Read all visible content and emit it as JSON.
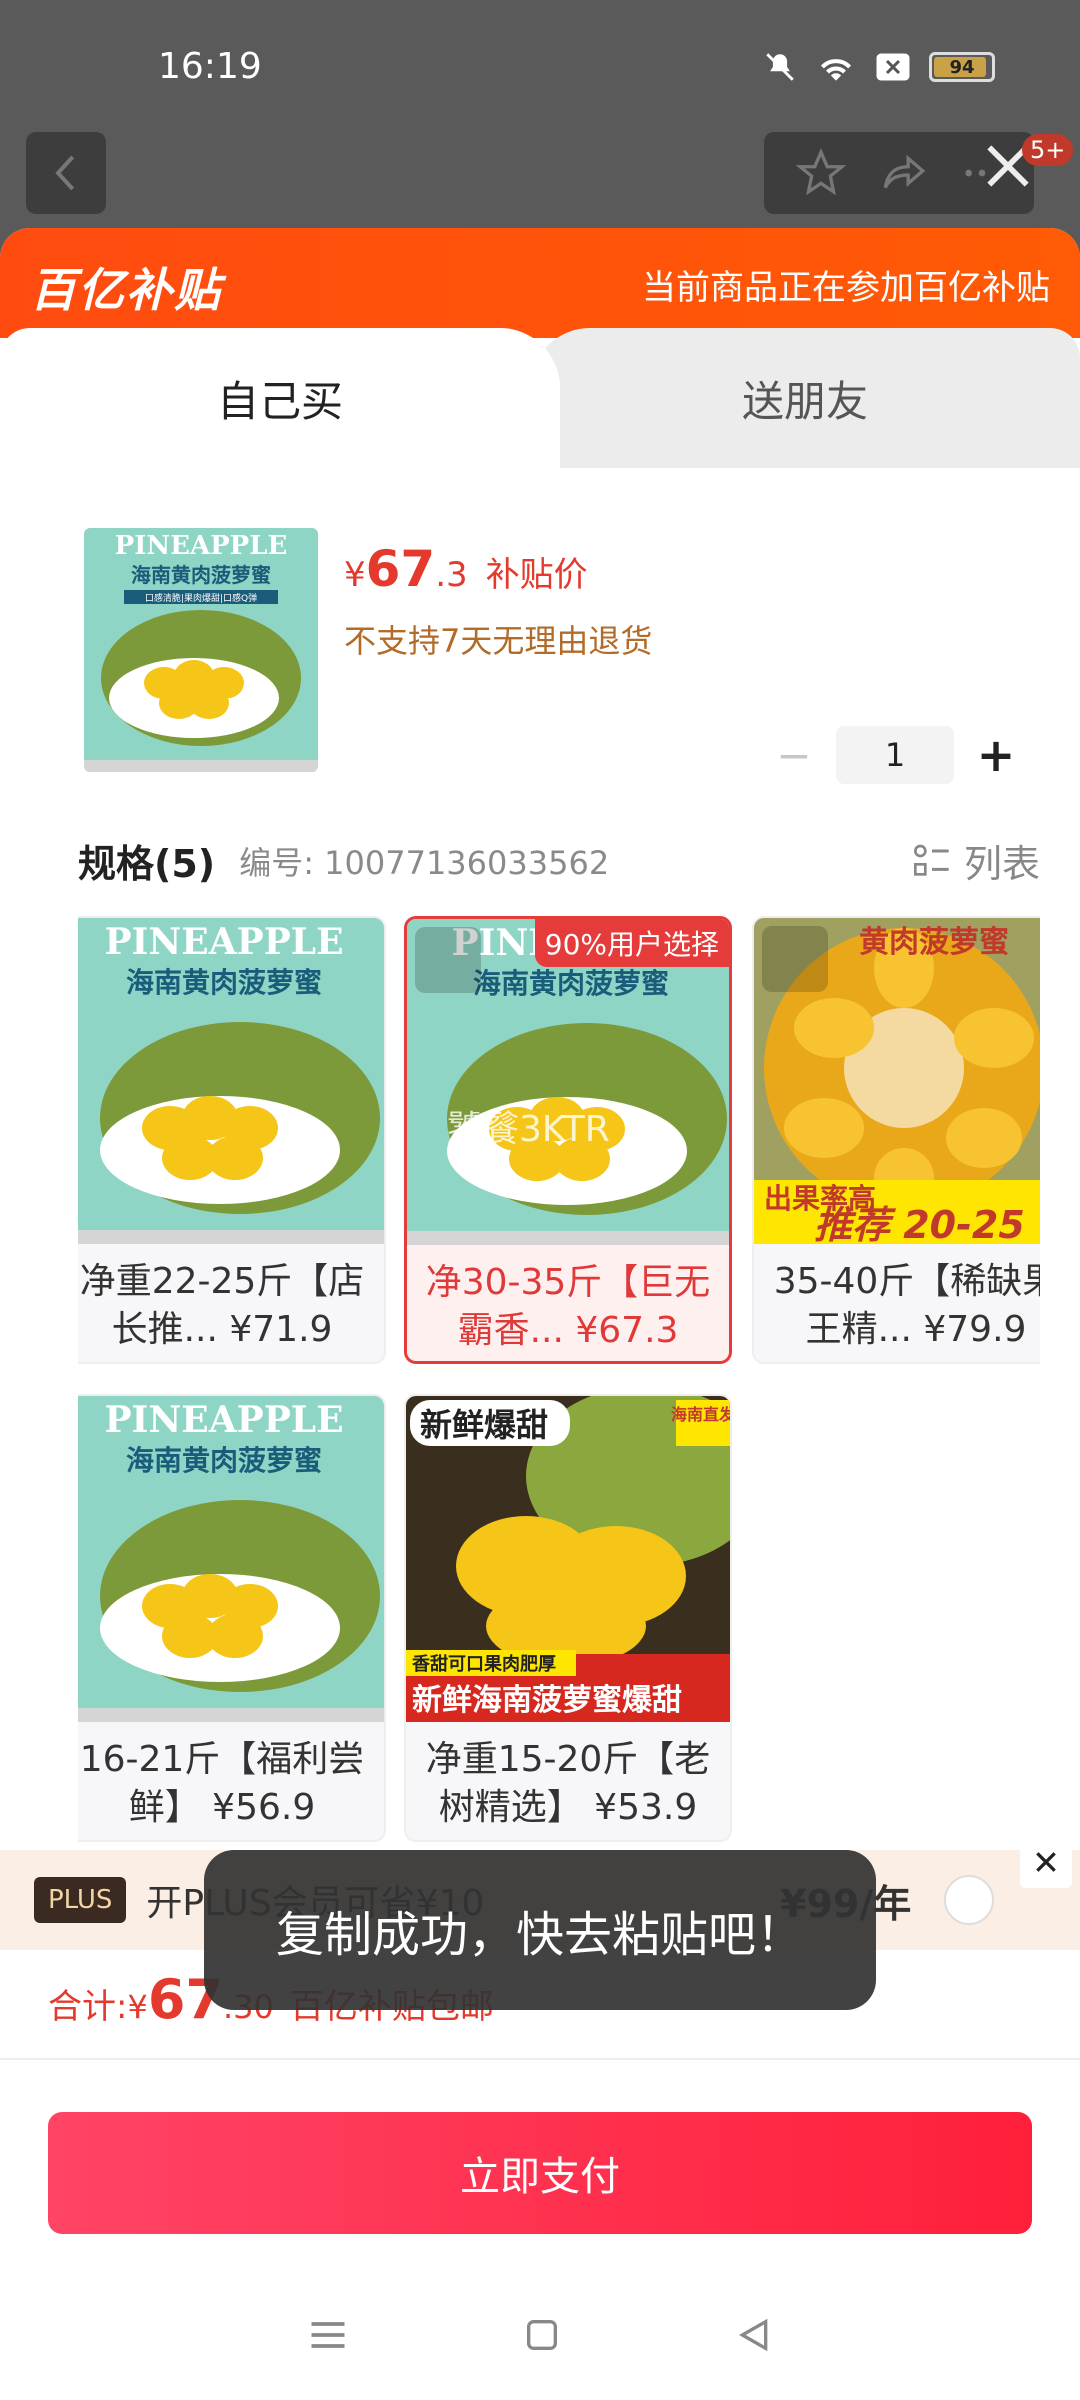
{
  "status_bar": {
    "time": "16:19",
    "battery": "94"
  },
  "nav": {
    "badge": "5+"
  },
  "header": {
    "brand": "百亿补贴",
    "message": "当前商品正在参加百亿补贴"
  },
  "tabs": [
    {
      "label": "自己买"
    },
    {
      "label": "送朋友"
    }
  ],
  "product": {
    "price_symbol": "¥",
    "price_int": "67",
    "price_dec": ".3",
    "price_label": "补贴价",
    "note": "不支持7天无理由退货",
    "quantity": "1"
  },
  "spec": {
    "title": "规格(5)",
    "code": "编号: 10077136033562",
    "list_label": "列表",
    "items": [
      {
        "text_line1": "净重22-25斤【店",
        "text_line2": "长推... ¥71.9"
      },
      {
        "text_line1": "净30-35斤【巨无",
        "text_line2": "霸香... ¥67.3",
        "tag": "90%用户选择",
        "watermark": "饕餮3KTR"
      },
      {
        "text_line1": "35-40斤【稀缺果",
        "text_line2": "王精... ¥79.9",
        "promo": "推荐 20-25",
        "promo_top": "出果率高",
        "promo_brand": "黄肉菠萝蜜"
      },
      {
        "text_line1": "16-21斤【福利尝",
        "text_line2": "鲜】 ¥56.9"
      },
      {
        "text_line1": "净重15-20斤【老",
        "text_line2": "树精选】 ¥53.9",
        "badge_top": "新鲜爆甜",
        "badge_corner": "海南直发",
        "footer_small": "香甜可口果肉肥厚",
        "footer_big": "新鲜海南菠萝蜜爆甜"
      }
    ],
    "poster_title": "PINEAPPLE",
    "poster_sub": "海南黄肉菠萝蜜",
    "poster_tags": "口感清脆|果肉爆甜|口感Q弹"
  },
  "plus_bar": {
    "badge": "PLUS",
    "text": "开PLUS会员可省¥10",
    "price": "¥99/年"
  },
  "total": {
    "label": "合计: ",
    "symbol": "¥",
    "int": "67",
    "dec": ".30",
    "note": "百亿补贴包邮"
  },
  "pay_button": "立即支付",
  "toast": "复制成功，快去粘贴吧！",
  "colors": {
    "accent": "#e43a2e",
    "header": "#ff4b10",
    "pay": "#ff1f3a"
  }
}
